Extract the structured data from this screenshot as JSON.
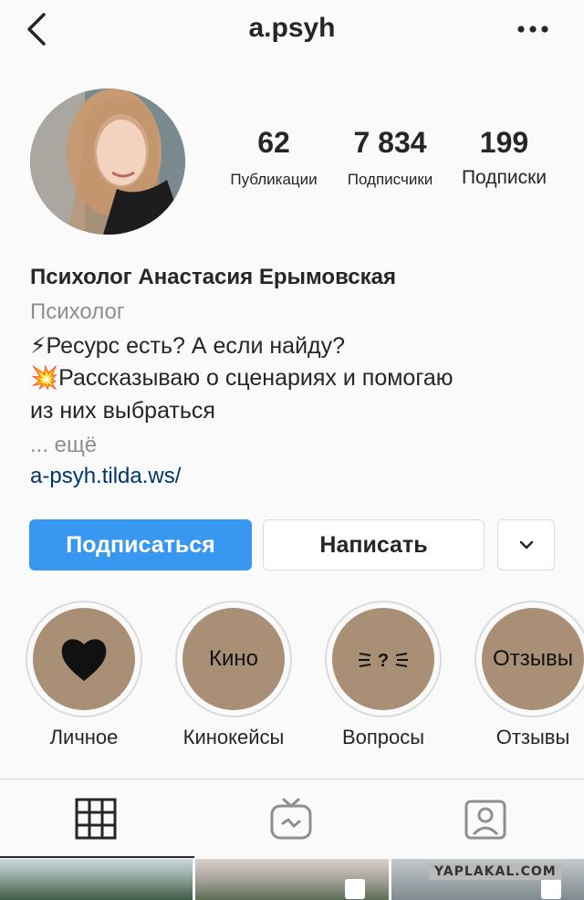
{
  "header": {
    "username": "a.psyh",
    "back_icon": "chevron-left-icon",
    "more_icon": "more-horizontal-icon"
  },
  "stats": [
    {
      "value": "62",
      "label": "Публикации"
    },
    {
      "value": "7 834",
      "label": "Подписчики"
    },
    {
      "value": "199",
      "label": "Подписки"
    }
  ],
  "profile": {
    "name": "Психолог Анастасия Ерымовская",
    "category": "Психолог",
    "bio": [
      "⚡Ресурс есть? А если найду?",
      "💥Рассказываю о сценариях и помогаю",
      "из них выбраться"
    ],
    "more": "... ещё",
    "link": "a-psyh.tilda.ws/"
  },
  "actions": {
    "follow": "Подписаться",
    "message": "Написать",
    "dropdown_icon": "chevron-down-icon"
  },
  "highlights": [
    {
      "label": "Личное",
      "cover_text": "",
      "icon": "heart-icon"
    },
    {
      "label": "Кинокейсы",
      "cover_text": "Кино",
      "icon": ""
    },
    {
      "label": "Вопросы",
      "cover_text": "?",
      "icon": "question-sparkle-icon"
    },
    {
      "label": "Отзывы",
      "cover_text": "Отзывы",
      "icon": ""
    }
  ],
  "tabs": [
    {
      "name": "grid",
      "icon": "grid-icon",
      "active": true
    },
    {
      "name": "igtv",
      "icon": "igtv-icon",
      "active": false
    },
    {
      "name": "tagged",
      "icon": "tagged-person-icon",
      "active": false
    }
  ],
  "watermark": "YAPLAKAL.COM",
  "colors": {
    "accent": "#3897f0",
    "link": "#00376b",
    "muted": "#8e8e8e",
    "highlight_cover": "#a88f76"
  }
}
